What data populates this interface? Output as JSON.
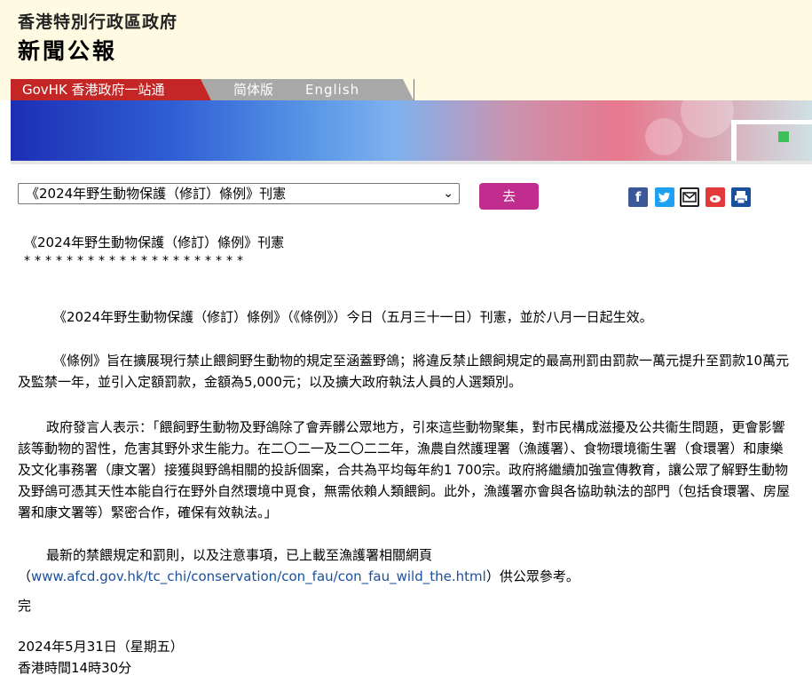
{
  "header": {
    "gov_name": "香港特別行政區政府",
    "title": "新聞公報"
  },
  "tabs": {
    "govhk": "GovHK 香港政府一站通",
    "simplified": "简体版",
    "english": "English"
  },
  "toolbar": {
    "select_value": "《2024年野生動物保護（修訂）條例》刊憲",
    "go_label": "去",
    "share_icons": [
      "facebook-icon",
      "twitter-icon",
      "email-icon",
      "weibo-icon",
      "print-icon"
    ]
  },
  "article": {
    "title": "《2024年野生動物保護（修訂）條例》刊憲",
    "stars": "*********************",
    "p1": "《2024年野生動物保護（修訂）條例》（《條例》）今日（五月三十一日）刊憲，並於八月一日起生效。",
    "p2": "《條例》旨在擴展現行禁止餵飼野生動物的規定至涵蓋野鴿；將違反禁止餵飼規定的最高刑罰由罰款一萬元提升至罰款10萬元及監禁一年，並引入定額罰款，金額為5,000元；以及擴大政府執法人員的人選類別。",
    "p3": "政府發言人表示：「餵飼野生動物及野鴿除了會弄髒公眾地方，引來這些動物聚集，對市民構成滋擾及公共衞生問題，更會影響該等動物的習性，危害其野外求生能力。在二〇二一及二〇二二年，漁農自然護理署（漁護署）、食物環境衞生署（食環署）和康樂及文化事務署（康文署）接獲與野鴿相關的投訴個案，合共為平均每年約1 700宗。政府將繼續加強宣傳教育，讓公眾了解野生動物及野鴿可憑其天性本能自行在野外自然環境中覓食，無需依賴人類餵飼。此外，漁護署亦會與各協助執法的部門（包括食環署、房屋署和康文署等）緊密合作，確保有效執法。」",
    "p4_prefix": "最新的禁餵規定和罰則，以及注意事項，已上載至漁護署相關網頁（",
    "p4_link": "www.afcd.gov.hk/tc_chi/conservation/con_fau/con_fau_wild_the.html",
    "p4_suffix": "）供公眾參考。",
    "end": "完",
    "date": "2024年5月31日（星期五）",
    "time": "香港時間14時30分"
  },
  "colors": {
    "header_bg": "#fffbe2",
    "govhk_tab": "#c42626",
    "go_button": "#c02d8e",
    "link": "#1a4f9c"
  }
}
